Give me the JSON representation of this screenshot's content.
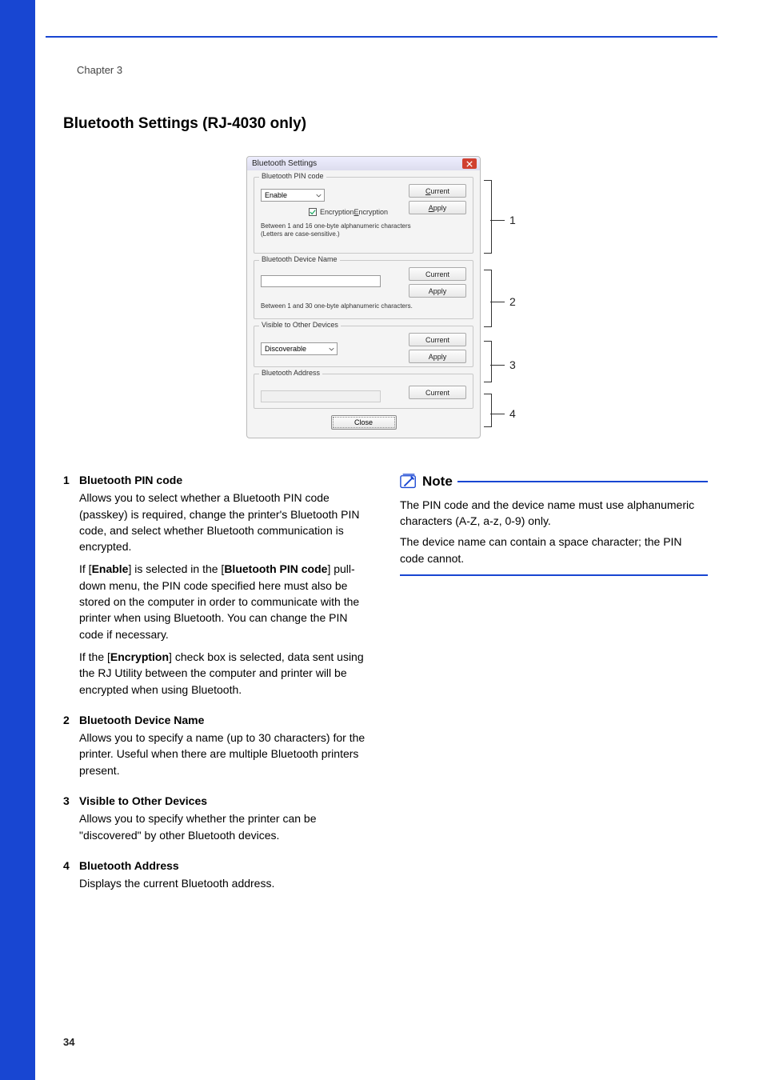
{
  "chapter": "Chapter 3",
  "heading": "Bluetooth Settings (RJ-4030 only)",
  "page_number": "34",
  "dialog": {
    "title": "Bluetooth Settings",
    "pin": {
      "legend": "Bluetooth PIN code",
      "select_value": "Enable",
      "encryption_label": "Encryption",
      "helper1": "Between 1 and 16 one-byte alphanumeric characters",
      "helper2": "(Letters are case-sensitive.)",
      "btn_current": "Current",
      "btn_apply": "Apply"
    },
    "name": {
      "legend": "Bluetooth Device Name",
      "helper": "Between 1 and 30 one-byte alphanumeric characters.",
      "btn_current": "Current",
      "btn_apply": "Apply"
    },
    "visible": {
      "legend": "Visible to Other Devices",
      "select_value": "Discoverable",
      "btn_current": "Current",
      "btn_apply": "Apply"
    },
    "address": {
      "legend": "Bluetooth Address",
      "btn_current": "Current"
    },
    "close": "Close"
  },
  "callouts": {
    "c1": "1",
    "c2": "2",
    "c3": "3",
    "c4": "4"
  },
  "items": {
    "i1": {
      "num": "1",
      "title": "Bluetooth PIN code",
      "p1a": "Allows you to select whether a Bluetooth PIN code (passkey) is required, change the printer's Bluetooth PIN code, and select whether Bluetooth communication is encrypted.",
      "p2a": "If [",
      "p2b": "Enable",
      "p2c": "] is selected in the [",
      "p2d": "Bluetooth PIN code",
      "p2e": "] pull-down menu, the PIN code specified here must also be stored on the computer in order to communicate with the printer when using Bluetooth. You can change the PIN code if necessary.",
      "p3a": "If the [",
      "p3b": "Encryption",
      "p3c": "] check box is selected, data sent using the RJ Utility between the computer and printer will be encrypted when using Bluetooth."
    },
    "i2": {
      "num": "2",
      "title": "Bluetooth Device Name",
      "p": "Allows you to specify a name (up to 30 characters) for the printer. Useful when there are multiple Bluetooth printers present."
    },
    "i3": {
      "num": "3",
      "title": "Visible to Other Devices",
      "p": "Allows you to specify whether the printer can be \"discovered\" by other Bluetooth devices."
    },
    "i4": {
      "num": "4",
      "title": "Bluetooth Address",
      "p": "Displays the current Bluetooth address."
    }
  },
  "note": {
    "title": "Note",
    "p1": "The PIN code and the device name must use alphanumeric characters (A-Z, a-z, 0-9) only.",
    "p2": "The device name can contain a space character; the PIN code cannot."
  }
}
